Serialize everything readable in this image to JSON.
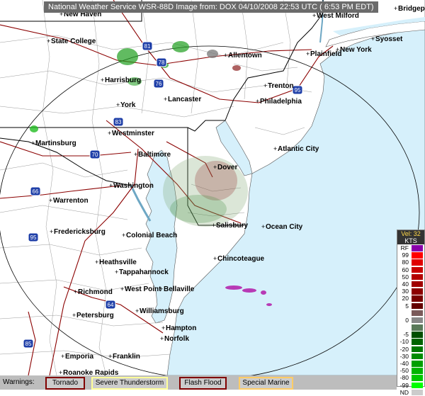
{
  "header": {
    "title": "National Weather Service WSR-88D Image from: DOX 04/10/2008 22:53 UTC ( 6:53 PM EDT)"
  },
  "cities": [
    {
      "name": "Bridgeport"
    },
    {
      "name": "West Milford"
    },
    {
      "name": "New Haven"
    },
    {
      "name": "State College"
    },
    {
      "name": "Syosset"
    },
    {
      "name": "New York"
    },
    {
      "name": "Plainfield"
    },
    {
      "name": "Allentown"
    },
    {
      "name": "Harrisburg"
    },
    {
      "name": "Trenton"
    },
    {
      "name": "Lancaster"
    },
    {
      "name": "Philadelphia"
    },
    {
      "name": "York"
    },
    {
      "name": "Westminster"
    },
    {
      "name": "Martinsburg"
    },
    {
      "name": "Atlantic City"
    },
    {
      "name": "Baltimore"
    },
    {
      "name": "Dover"
    },
    {
      "name": "Washington"
    },
    {
      "name": "Warrenton"
    },
    {
      "name": "Salisbury"
    },
    {
      "name": "Ocean City"
    },
    {
      "name": "Fredericksburg"
    },
    {
      "name": "Colonial Beach"
    },
    {
      "name": "Chincoteague"
    },
    {
      "name": "Heathsville"
    },
    {
      "name": "Tappahannock"
    },
    {
      "name": "West Point"
    },
    {
      "name": "Bellaville"
    },
    {
      "name": "Richmond"
    },
    {
      "name": "Williamsburg"
    },
    {
      "name": "Petersburg"
    },
    {
      "name": "Hampton"
    },
    {
      "name": "Norfolk"
    },
    {
      "name": "Emporia"
    },
    {
      "name": "Franklin"
    },
    {
      "name": "Roanoke Rapids"
    }
  ],
  "highways": [
    "81",
    "78",
    "76",
    "95",
    "83",
    "70",
    "66",
    "95",
    "64",
    "85"
  ],
  "legend": {
    "title": "Vel: 32",
    "unit": "KTS",
    "items": [
      {
        "label": "RF",
        "color": "#8a00aa"
      },
      {
        "label": "99",
        "color": "#ff0000"
      },
      {
        "label": "80",
        "color": "#e00000"
      },
      {
        "label": "60",
        "color": "#c80000"
      },
      {
        "label": "50",
        "color": "#b40000"
      },
      {
        "label": "40",
        "color": "#a00000"
      },
      {
        "label": "30",
        "color": "#8c0000"
      },
      {
        "label": "20",
        "color": "#780000"
      },
      {
        "label": "5",
        "color": "#640000"
      },
      {
        "label": "",
        "color": "#7a5a5a"
      },
      {
        "label": "0",
        "color": "#888888"
      },
      {
        "label": "",
        "color": "#5a7a5a"
      },
      {
        "label": "-5",
        "color": "#004f00"
      },
      {
        "label": "-10",
        "color": "#006400"
      },
      {
        "label": "-20",
        "color": "#007800"
      },
      {
        "label": "-30",
        "color": "#008c00"
      },
      {
        "label": "-40",
        "color": "#00a000"
      },
      {
        "label": "-50",
        "color": "#00b400"
      },
      {
        "label": "-80",
        "color": "#00c800"
      },
      {
        "label": "-99",
        "color": "#00ff00"
      },
      {
        "label": "ND",
        "color": "#cccccc"
      }
    ]
  },
  "warnings": {
    "title": "Warnings:",
    "buttons": [
      {
        "label": "Tornado",
        "color": "#800000"
      },
      {
        "label": "Severe Thunderstorm",
        "color": "#ffff99"
      },
      {
        "label": "Flash Flood",
        "color": "#800000"
      },
      {
        "label": "Special Marine",
        "color": "#ffcc66"
      }
    ]
  },
  "colors": {
    "land": "#ffffff",
    "water": "#d6f0fb",
    "range_ring": "#000000",
    "state_border": "#000000",
    "county_line": "#888888",
    "highway": "#8b0000"
  }
}
